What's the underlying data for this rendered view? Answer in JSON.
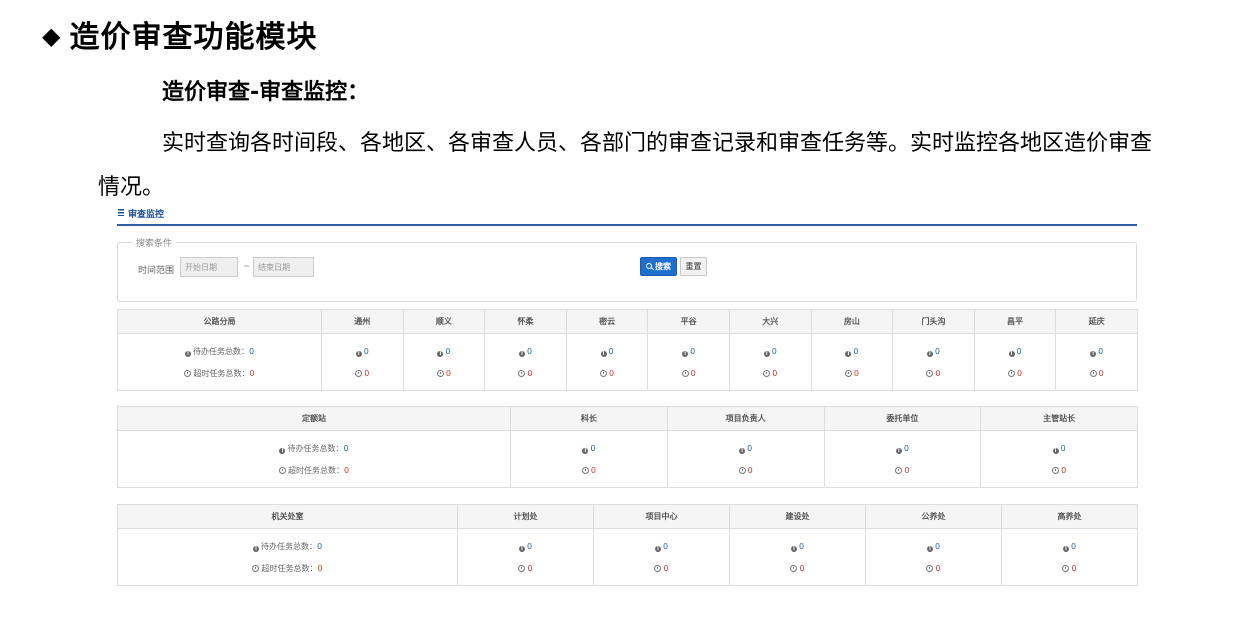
{
  "slide": {
    "bullet": "◆",
    "title": "造价审查功能模块",
    "subtitle": "造价审查-审查监控：",
    "description": "实时查询各时间段、各地区、各审查人员、各部门的审查记录和审查任务等。实时监控各地区造价审查情况。"
  },
  "app": {
    "title": "审查监控",
    "search": {
      "legend": "搜索条件",
      "range_label": "时间范围",
      "start_placeholder": "开始日期",
      "separator": "~",
      "end_placeholder": "结束日期",
      "search_button": "搜索",
      "reset_button": "重置"
    },
    "colors": {
      "accent": "#1f6fcf",
      "count_blue": "#2b65b4",
      "count_red": "#d9352b"
    },
    "tables": [
      {
        "headers": [
          "公路分局",
          "通州",
          "顺义",
          "怀柔",
          "密云",
          "平谷",
          "大兴",
          "房山",
          "门头沟",
          "昌平",
          "延庆"
        ],
        "pending_label": "待办任务总数：",
        "overdue_label": "超时任务总数：",
        "pending": [
          "0",
          "0",
          "0",
          "0",
          "0",
          "0",
          "0",
          "0",
          "0",
          "0",
          "0"
        ],
        "overdue": [
          "0",
          "0",
          "0",
          "0",
          "0",
          "0",
          "0",
          "0",
          "0",
          "0",
          "0"
        ]
      },
      {
        "headers": [
          "定额站",
          "科长",
          "项目负责人",
          "委托单位",
          "主管站长"
        ],
        "pending_label": "待办任务总数：",
        "overdue_label": "超时任务总数：",
        "pending": [
          "0",
          "0",
          "0",
          "0",
          "0"
        ],
        "overdue": [
          "0",
          "0",
          "0",
          "0",
          "0"
        ]
      },
      {
        "headers": [
          "机关处室",
          "计划处",
          "项目中心",
          "建设处",
          "公养处",
          "高养处"
        ],
        "pending_label": "待办任务总数：",
        "overdue_label": "超时任务总数：",
        "pending": [
          "0",
          "0",
          "0",
          "0",
          "0",
          "0"
        ],
        "overdue": [
          "0",
          "0",
          "0",
          "0",
          "0",
          "0"
        ]
      }
    ]
  }
}
